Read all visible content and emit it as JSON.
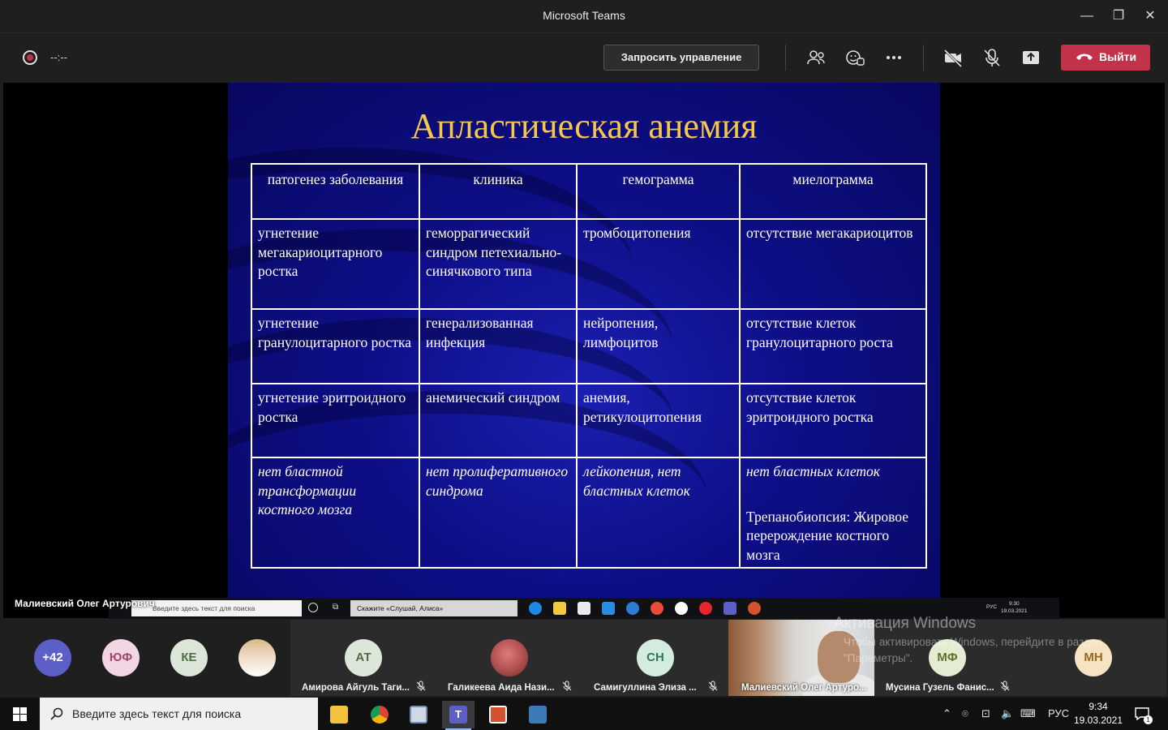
{
  "window": {
    "title": "Microsoft Teams",
    "minimize": "—",
    "restore": "❐",
    "close": "✕"
  },
  "toolbar": {
    "timer": "--:--",
    "request_control": "Запросить управление",
    "leave": "Выйти",
    "leave_color": "#c4314b"
  },
  "slide": {
    "title": "Апластическая анемия",
    "title_color": "#f5c84c",
    "headers": [
      "патогенез заболевания",
      "клиника",
      "гемограмма",
      "миелограмма"
    ],
    "rows": [
      [
        "угнетение мегакариоцитарного ростка",
        "геморрагический синдром петехиально-синячкового типа",
        "тромбоцитопения",
        "отсутствие мегакариоцитов"
      ],
      [
        "угнетение гранулоцитарного ростка",
        "генерализованная инфекция",
        "нейропения, лимфоцитов",
        "отсутствие клеток гранулоцитарного роста"
      ],
      [
        "угнетение эритроидного ростка",
        "анемический синдром",
        "анемия, ретикулоцитопения",
        "отсутствие клеток эритроидного ростка"
      ],
      [
        "нет бластной трансформации костного мозга",
        "нет пролиферативного синдрома",
        "лейкопения, нет бластных клеток",
        "нет бластных клеток"
      ]
    ],
    "extra_note": "Трепанобиопсия: Жировое перерождение костного мозга"
  },
  "shared_screen": {
    "presenter": "Малиевский Олег Артурович",
    "search_placeholder": "Введите здесь текст для поиска",
    "cortana": "Скажите «Слушай, Алиса»",
    "lang": "РУС",
    "time": "9:30",
    "date": "19.03.2021"
  },
  "participants": {
    "overflow": "+42",
    "avatars": [
      {
        "initials": "ЮФ",
        "bg": "#f3d6e4",
        "fg": "#a3456c"
      },
      {
        "initials": "КЕ",
        "bg": "#dde7d9",
        "fg": "#4d6b45"
      }
    ],
    "tiles": [
      {
        "initials": "АТ",
        "name": "Амирова Айгуль Таги...",
        "bg": "#dde7d9",
        "fg": "#4d6b45"
      },
      {
        "initials": "",
        "name": "Галикеева Аида Нази...",
        "bg": "#c86a6a",
        "fg": "#ffffff"
      },
      {
        "initials": "СН",
        "name": "Самигуллина Элиза ...",
        "bg": "#d4ecdf",
        "fg": "#2f7a55"
      },
      {
        "initials": "МФ",
        "name": "Мусина Гузель Фанис...",
        "bg": "#e4ecd2",
        "fg": "#5c7230"
      },
      {
        "initials": "МН",
        "name": "",
        "bg": "#f6e3c2",
        "fg": "#9a6a1c"
      }
    ],
    "video_name": "Малиевский Олег Артуро...",
    "watermark_title": "Активация Windows",
    "watermark_text": "Чтобы активировать Windows, перейдите в раздел \"Параметры\"."
  },
  "taskbar": {
    "search_placeholder": "Введите здесь текст для поиска",
    "lang": "РУС",
    "time": "9:34",
    "date": "19.03.2021",
    "notifications": "1"
  }
}
